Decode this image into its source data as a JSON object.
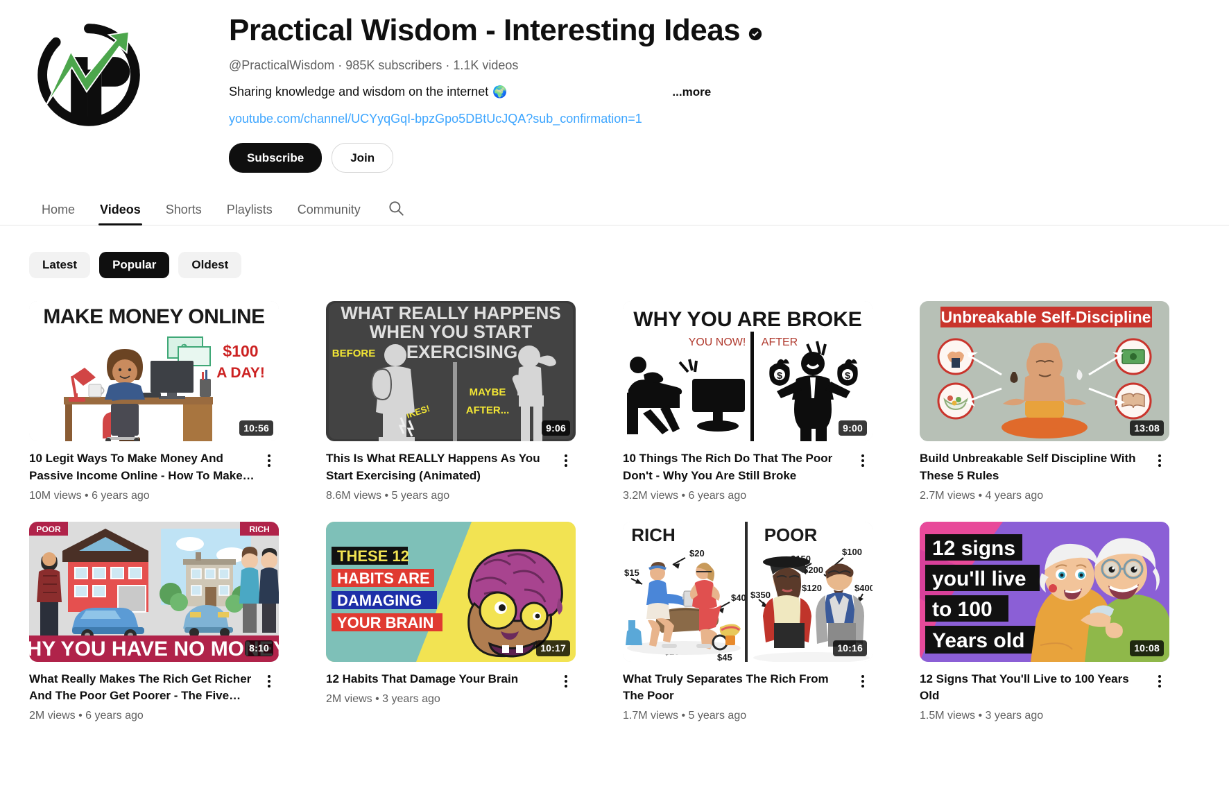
{
  "channel": {
    "name": "Practical Wisdom - Interesting Ideas",
    "verified_icon": "verified-badge-icon",
    "handle": "@PracticalWisdom",
    "subscribers": "985K subscribers",
    "video_count": "1.1K videos",
    "meta_line": "@PracticalWisdom · 985K subscribers · 1.1K videos",
    "description": "Sharing knowledge and wisdom on the internet",
    "description_emoji": "🌍",
    "more_label": "...more",
    "link": "youtube.com/channel/UCYyqGqI-bpzGpo5DBtUcJQA?sub_confirmation=1",
    "subscribe_label": "Subscribe",
    "join_label": "Join",
    "avatar_colors": {
      "ring": "#000000",
      "arrow": "#4CA64C"
    }
  },
  "tabs": [
    {
      "label": "Home",
      "active": false
    },
    {
      "label": "Videos",
      "active": true
    },
    {
      "label": "Shorts",
      "active": false
    },
    {
      "label": "Playlists",
      "active": false
    },
    {
      "label": "Community",
      "active": false
    }
  ],
  "search_icon": "search-icon",
  "filters": [
    {
      "label": "Latest",
      "active": false
    },
    {
      "label": "Popular",
      "active": true
    },
    {
      "label": "Oldest",
      "active": false
    }
  ],
  "videos": [
    {
      "title": "10 Legit Ways To Make Money And Passive Income Online - How To Make Money Online",
      "views": "10M views",
      "age": "6 years ago",
      "stats": "10M views • 6 years ago",
      "duration": "10:56",
      "thumb_id": "thumb-make-money-online",
      "thumb_text": {
        "headline": "MAKE MONEY ONLINE",
        "badge_1": "$100",
        "badge_2": "A DAY!"
      }
    },
    {
      "title": "This Is What REALLY Happens As You Start Exercising (Animated)",
      "views": "8.6M views",
      "age": "5 years ago",
      "stats": "8.6M views • 5 years ago",
      "duration": "9:06",
      "thumb_id": "thumb-start-exercising",
      "thumb_text": {
        "line_1": "WHAT REALLY HAPPENS",
        "line_2": "WHEN YOU START",
        "line_3": "EXERCISING",
        "label_before": "BEFORE",
        "label_yikes": "YIKES!",
        "label_maybe": "MAYBE",
        "label_after": "AFTER..."
      }
    },
    {
      "title": "10 Things The Rich Do That The Poor Don't - Why You Are Still Broke",
      "views": "3.2M views",
      "age": "6 years ago",
      "stats": "3.2M views • 6 years ago",
      "duration": "9:00",
      "thumb_id": "thumb-why-you-are-broke",
      "thumb_text": {
        "headline": "WHY YOU ARE BROKE",
        "label_left": "YOU NOW!",
        "label_right": "AFTER"
      }
    },
    {
      "title": "Build Unbreakable Self Discipline With These 5 Rules",
      "views": "2.7M views",
      "age": "4 years ago",
      "stats": "2.7M views • 4 years ago",
      "duration": "13:08",
      "thumb_id": "thumb-unbreakable-self-discipline",
      "thumb_text": {
        "headline": "Unbreakable Self-Discipline"
      }
    },
    {
      "title": "What Really Makes The Rich Get Richer And The Poor Get Poorer - The Five Laws Of Gold",
      "views": "2M views",
      "age": "6 years ago",
      "stats": "2M views • 6 years ago",
      "duration": "8:10",
      "thumb_id": "thumb-why-you-have-no-money",
      "thumb_text": {
        "tag_left": "POOR",
        "tag_right": "RICH",
        "banner": "WHY YOU HAVE NO MONEY"
      }
    },
    {
      "title": "12 Habits That Damage Your Brain",
      "views": "2M views",
      "age": "3 years ago",
      "stats": "2M views • 3 years ago",
      "duration": "10:17",
      "thumb_id": "thumb-habits-damage-brain",
      "thumb_text": {
        "line_1": "THESE 12",
        "line_2": "HABITS ARE",
        "line_3": "DAMAGING",
        "line_4": "YOUR BRAIN"
      }
    },
    {
      "title": "What Truly Separates The Rich From The Poor",
      "views": "1.7M views",
      "age": "5 years ago",
      "stats": "1.7M views • 5 years ago",
      "duration": "10:16",
      "thumb_id": "thumb-rich-vs-poor",
      "thumb_text": {
        "tag_left": "RICH",
        "tag_right": "POOR",
        "prices_left": [
          "$15",
          "$20",
          "$40",
          "$25",
          "$45"
        ],
        "prices_right": [
          "$150",
          "$100",
          "$200",
          "$120",
          "$350",
          "$400"
        ]
      }
    },
    {
      "title": "12 Signs That You'll Live to 100 Years Old",
      "views": "1.5M views",
      "age": "3 years ago",
      "stats": "1.5M views • 3 years ago",
      "duration": "10:08",
      "thumb_id": "thumb-live-to-100",
      "thumb_text": {
        "line_1": "12 signs",
        "line_2": "you'll live",
        "line_3": "to 100",
        "line_4": "Years old"
      }
    }
  ],
  "menu_icon": "three-dot-menu-icon"
}
